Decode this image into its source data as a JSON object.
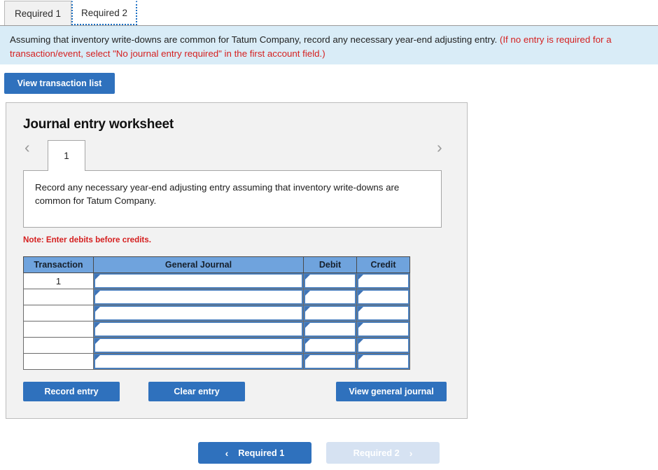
{
  "tabs": [
    {
      "label": "Required 1",
      "active": false
    },
    {
      "label": "Required 2",
      "active": true
    }
  ],
  "banner": {
    "text_black": "Assuming that inventory write-downs are common for Tatum Company, record any necessary year-end adjusting entry.",
    "text_red": "(If no entry is required for a transaction/event, select \"No journal entry required\" in the first account field.)"
  },
  "toolbar": {
    "view_transaction_list_label": "View transaction list"
  },
  "worksheet": {
    "title": "Journal entry worksheet",
    "pager": {
      "prev_icon": "chevron-left-icon",
      "next_icon": "chevron-right-icon",
      "current_page": "1"
    },
    "description": "Record any necessary year-end adjusting entry assuming that inventory write-downs are common for Tatum Company.",
    "note": "Note: Enter debits before credits.",
    "table": {
      "headers": [
        "Transaction",
        "General Journal",
        "Debit",
        "Credit"
      ],
      "rows": [
        {
          "transaction": "1",
          "general_journal": "",
          "debit": "",
          "credit": ""
        },
        {
          "transaction": "",
          "general_journal": "",
          "debit": "",
          "credit": ""
        },
        {
          "transaction": "",
          "general_journal": "",
          "debit": "",
          "credit": ""
        },
        {
          "transaction": "",
          "general_journal": "",
          "debit": "",
          "credit": ""
        },
        {
          "transaction": "",
          "general_journal": "",
          "debit": "",
          "credit": ""
        },
        {
          "transaction": "",
          "general_journal": "",
          "debit": "",
          "credit": ""
        }
      ]
    },
    "actions": {
      "record_entry_label": "Record entry",
      "clear_entry_label": "Clear entry",
      "view_general_journal_label": "View general journal"
    }
  },
  "footer": {
    "prev_label": "Required 1",
    "next_label": "Required 2",
    "prev_icon": "chevron-left-icon",
    "next_icon": "chevron-right-icon"
  },
  "colors": {
    "accent_blue": "#2f71bd",
    "table_header_blue": "#6fa3dd",
    "banner_blue": "#d9ecf7",
    "panel_gray": "#f2f2f2",
    "alert_red": "#d52020",
    "disabled_blue": "#d6e2f2"
  }
}
